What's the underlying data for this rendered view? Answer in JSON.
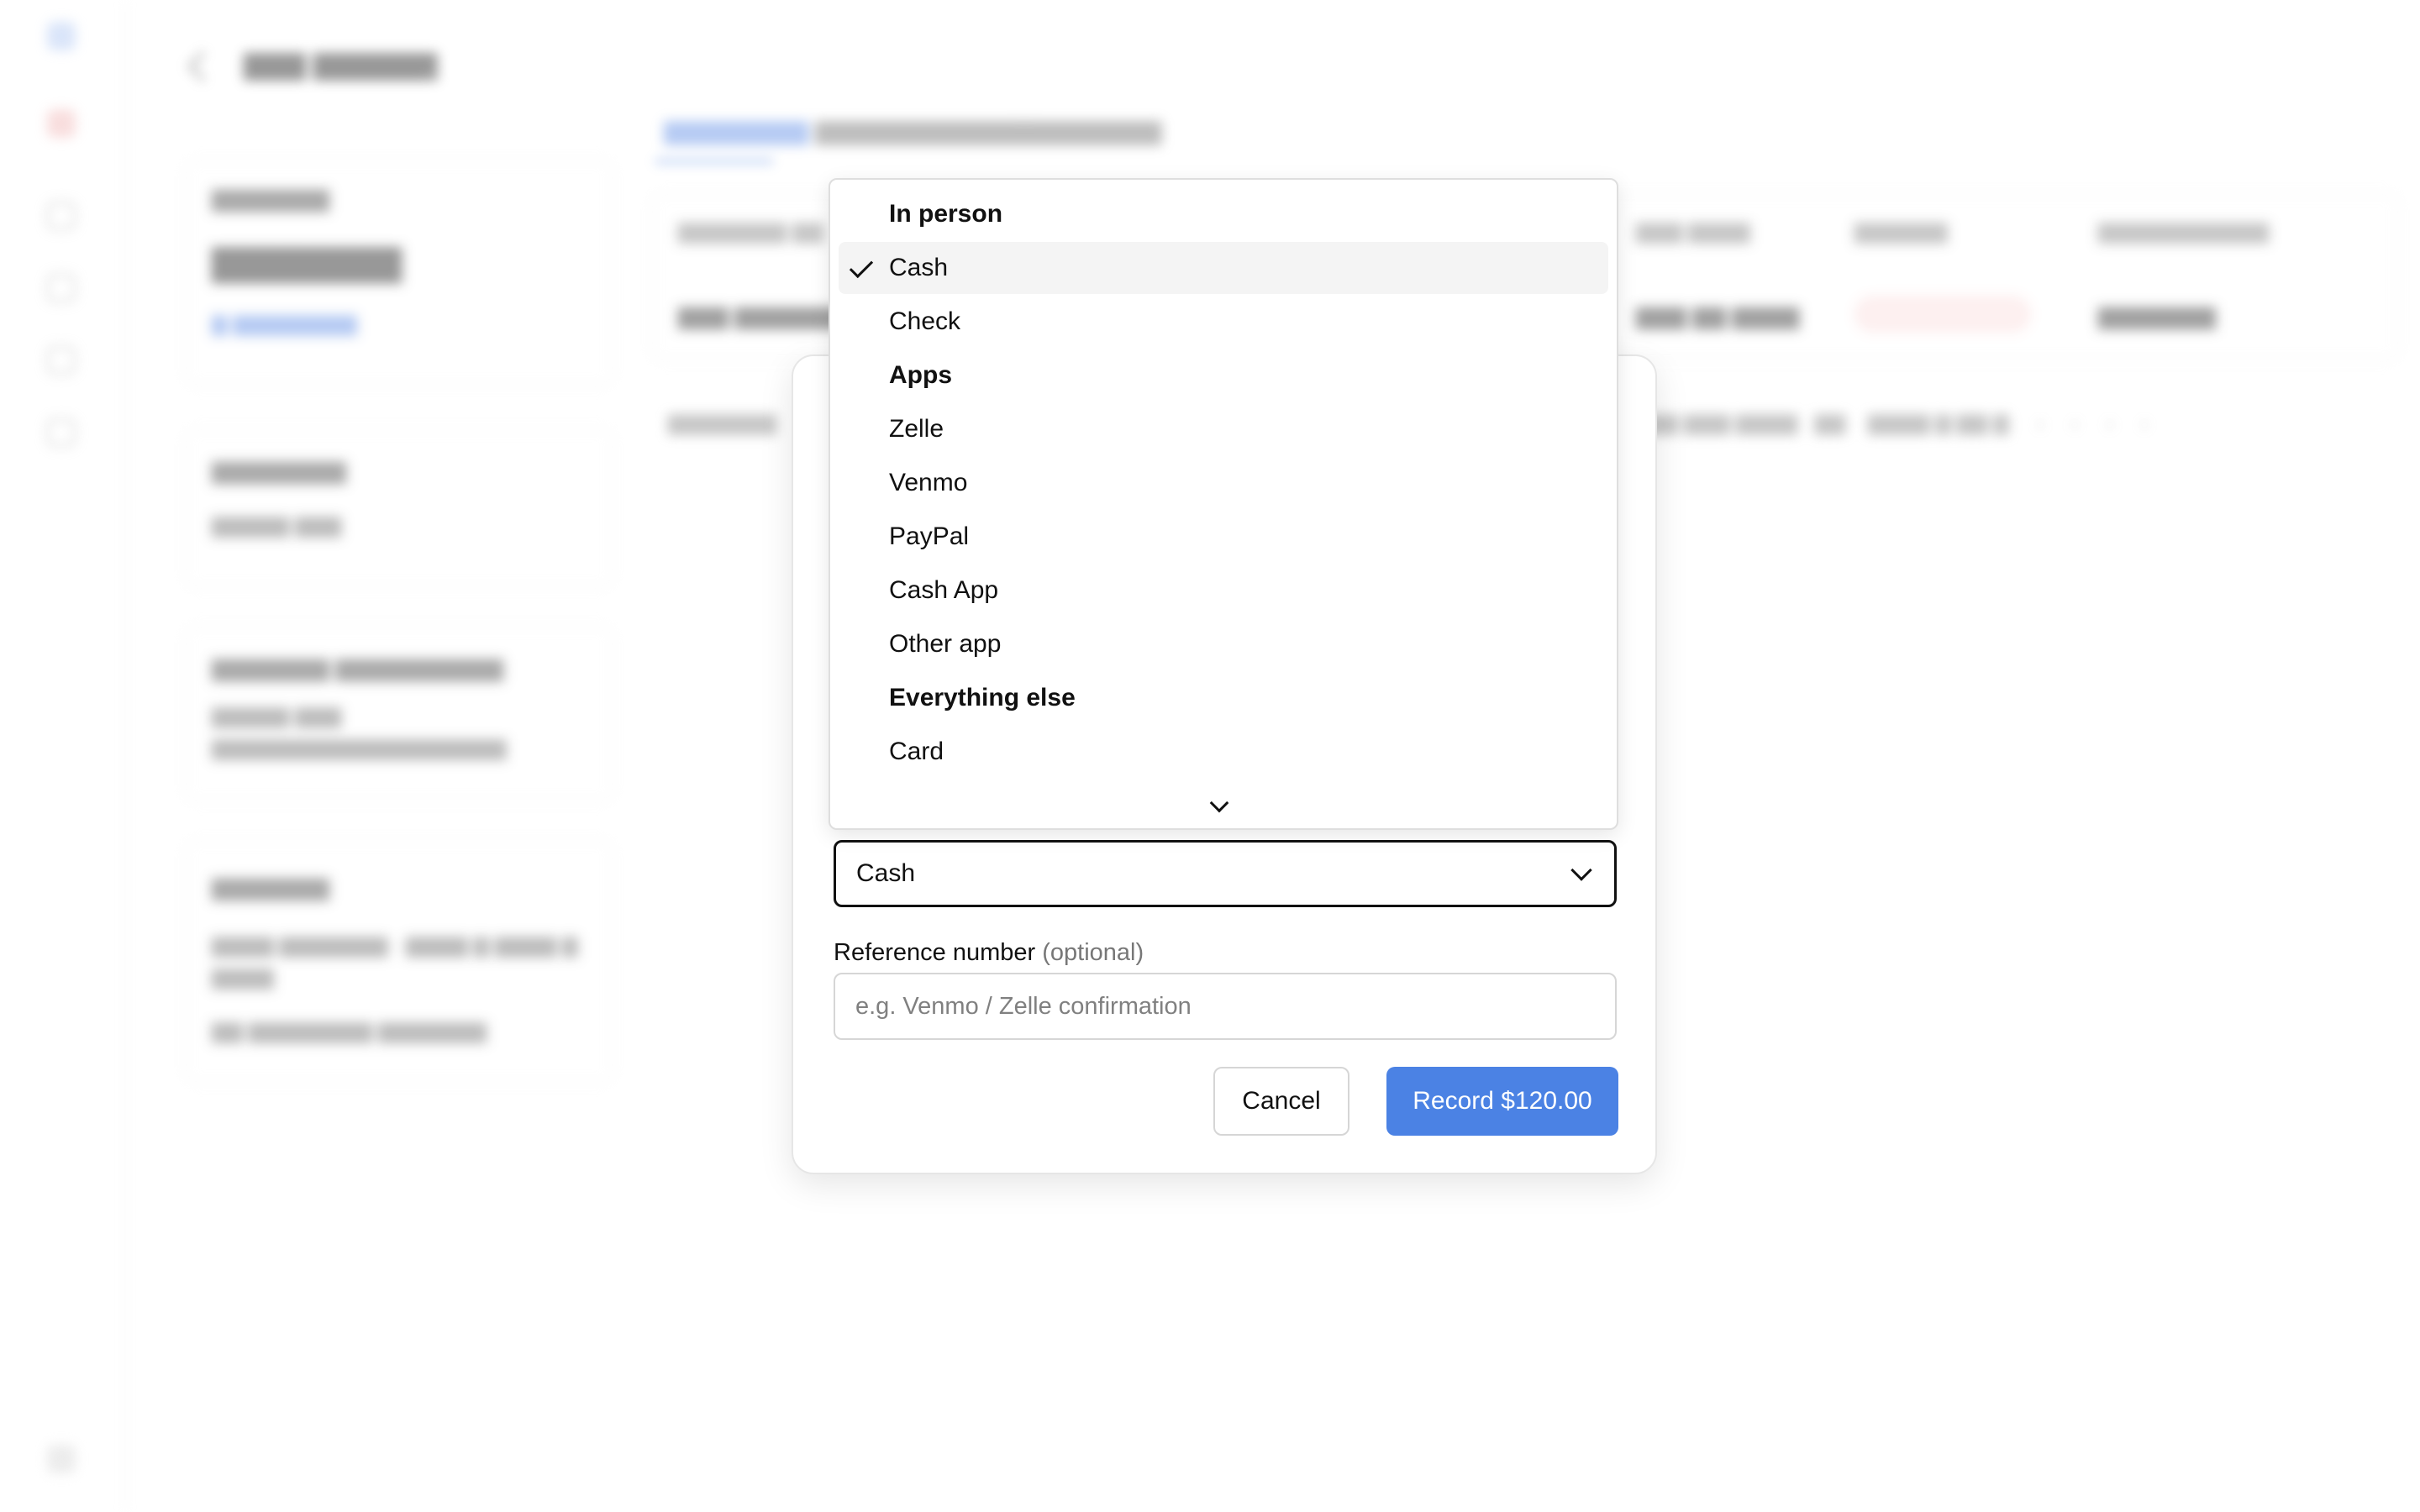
{
  "dropdown": {
    "groups": [
      {
        "label": "In person",
        "options": [
          {
            "label": "Cash",
            "selected": true
          },
          {
            "label": "Check"
          }
        ]
      },
      {
        "label": "Apps",
        "options": [
          {
            "label": "Zelle"
          },
          {
            "label": "Venmo"
          },
          {
            "label": "PayPal"
          },
          {
            "label": "Cash App"
          },
          {
            "label": "Other app"
          }
        ]
      },
      {
        "label": "Everything else",
        "options": [
          {
            "label": "Card"
          }
        ]
      }
    ],
    "icons": {
      "selected": "check-icon",
      "scroll": "chevron-down-icon"
    }
  },
  "modal": {
    "method_select": {
      "value": "Cash",
      "icon": "chevron-down-icon"
    },
    "reference": {
      "label": "Reference number",
      "optional": "(optional)",
      "placeholder": "e.g. Venmo / Zelle confirmation"
    },
    "buttons": {
      "cancel": "Cancel",
      "record": "Record $120.00"
    }
  },
  "colors": {
    "primary": "#4b82e4",
    "border": "#d6d6d6",
    "selected_row": "#f4f4f4"
  }
}
